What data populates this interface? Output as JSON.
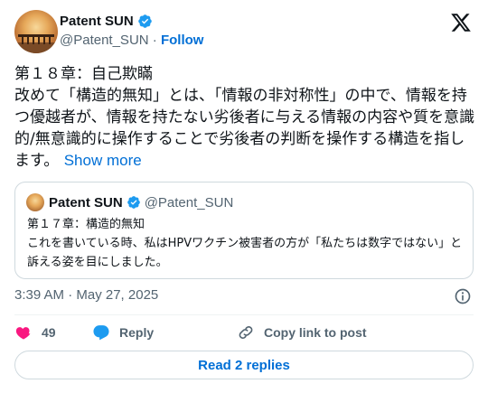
{
  "author": {
    "display_name": "Patent SUN",
    "handle": "@Patent_SUN",
    "separator": "·",
    "follow_label": "Follow"
  },
  "tweet": {
    "text": "第１８章：自己欺瞞\n改めて「構造的無知」とは、「情報の非対称性」の中で、情報を持つ優越者が、情報を持たない劣後者に与える情報の内容や質を意識的/無意識的に操作することで劣後者の判断を操作する構造を指します。 ",
    "show_more_label": "Show more",
    "timestamp": "3:39 AM · May 27, 2025"
  },
  "quoted": {
    "display_name": "Patent SUN",
    "handle": "@Patent_SUN",
    "text": "第１７章：構造的無知\nこれを書いている時、私はHPVワクチン被害者の方が「私たちは数字ではない」と訴える姿を目にしました。"
  },
  "actions": {
    "like_count": "49",
    "reply_label": "Reply",
    "copy_link_label": "Copy link to post"
  },
  "read_replies_label": "Read 2 replies",
  "colors": {
    "accent": "#006fd6",
    "like": "#f91880",
    "reply": "#1d9bf0",
    "muted": "#536471",
    "border": "#cfd9de"
  },
  "icons": [
    "verified-badge-icon",
    "x-logo-icon",
    "info-icon",
    "heart-icon",
    "reply-bubble-icon",
    "link-icon"
  ]
}
